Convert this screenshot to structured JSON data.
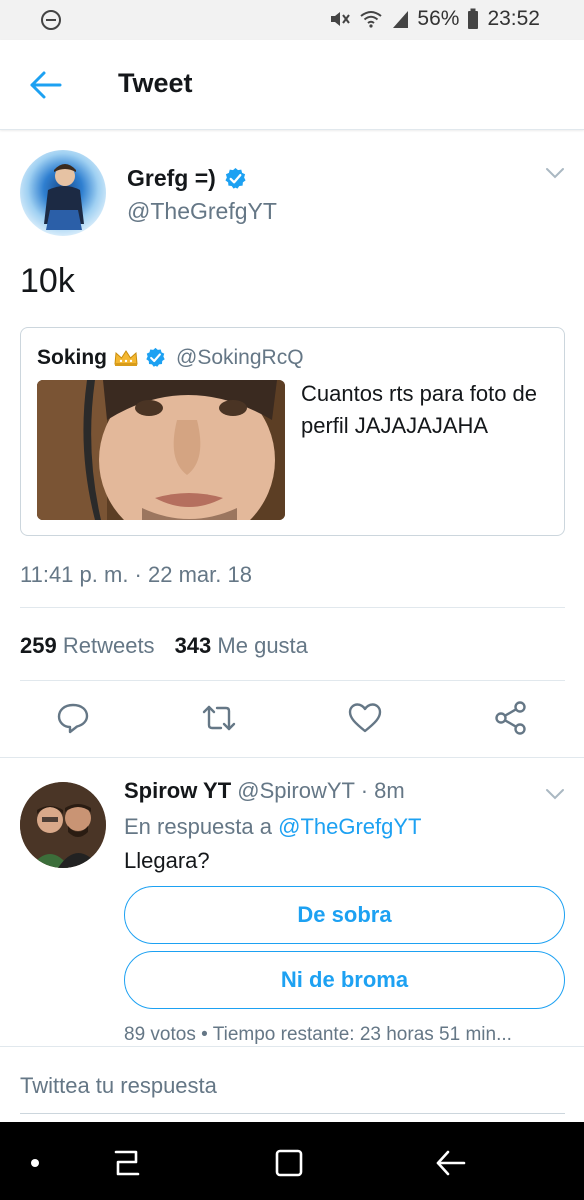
{
  "status_bar": {
    "battery_percent": "56%",
    "time": "23:52"
  },
  "header": {
    "title": "Tweet"
  },
  "tweet": {
    "author_name": "Grefg =)",
    "author_handle": "@TheGrefgYT",
    "text": "10k",
    "timestamp": "11:41 p. m. · 22 mar. 18",
    "retweets_count": "259",
    "retweets_label": "Retweets",
    "likes_count": "343",
    "likes_label": "Me gusta"
  },
  "quoted_tweet": {
    "author_name": "Soking",
    "author_handle": "@SokingRcQ",
    "text": "Cuantos rts para foto de perfil JAJAJAJAHA"
  },
  "reply": {
    "author_name": "Spirow YT",
    "author_handle": "@SpirowYT",
    "time_ago": "· 8m",
    "in_reply_to_label": "En respuesta a",
    "in_reply_to_handle": "@TheGrefgYT",
    "text": "Llegara?",
    "poll": {
      "options": [
        "De sobra",
        "Ni de broma"
      ],
      "meta": "89 votos • Tiempo restante: 23 horas 51 min..."
    }
  },
  "compose": {
    "placeholder": "Twittea tu respuesta"
  },
  "colors": {
    "accent": "#1da1f2",
    "secondary_text": "#657786",
    "divider": "#e1e8ed"
  }
}
